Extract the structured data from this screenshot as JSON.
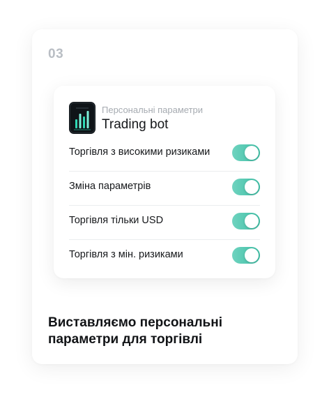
{
  "step": {
    "number": "03"
  },
  "bot": {
    "subtitle": "Персональні параметри",
    "title": "Trading bot",
    "logo_icon": "bar-chart-icon",
    "logo_colors": [
      "#0f1418",
      "#2fd8b4",
      "#7ef0da"
    ]
  },
  "settings": [
    {
      "label": "Торгівля з високими ризиками",
      "enabled": true
    },
    {
      "label": "Зміна параметрів",
      "enabled": true
    },
    {
      "label": "Торгівля тільки USD",
      "enabled": true
    },
    {
      "label": "Торгівля з мін. ризиками",
      "enabled": true
    }
  ],
  "caption": "Виставляємо персональні параметри для торгівлі",
  "colors": {
    "toggle_on_start": "#6fd3bf",
    "toggle_on_end": "#3dbfa5",
    "step_number": "#b9bec4",
    "subtitle": "#a6abb1",
    "text": "#16181b"
  }
}
